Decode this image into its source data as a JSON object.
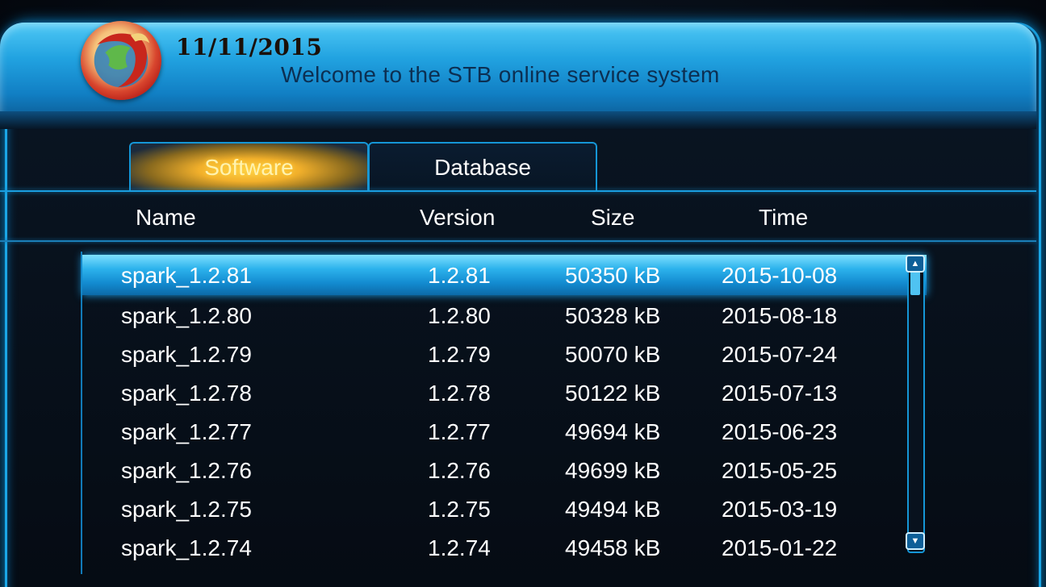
{
  "header": {
    "date": "11/11/2015",
    "welcome": "Welcome to the STB online service system"
  },
  "tabs": [
    {
      "label": "Software",
      "active": true
    },
    {
      "label": "Database",
      "active": false
    }
  ],
  "columns": {
    "name": "Name",
    "version": "Version",
    "size": "Size",
    "time": "Time"
  },
  "rows": [
    {
      "name": "spark_1.2.81",
      "version": "1.2.81",
      "size": "50350 kB",
      "time": "2015-10-08",
      "selected": true
    },
    {
      "name": "spark_1.2.80",
      "version": "1.2.80",
      "size": "50328 kB",
      "time": "2015-08-18"
    },
    {
      "name": "spark_1.2.79",
      "version": "1.2.79",
      "size": "50070 kB",
      "time": "2015-07-24"
    },
    {
      "name": "spark_1.2.78",
      "version": "1.2.78",
      "size": "50122 kB",
      "time": "2015-07-13"
    },
    {
      "name": "spark_1.2.77",
      "version": "1.2.77",
      "size": "49694 kB",
      "time": "2015-06-23"
    },
    {
      "name": "spark_1.2.76",
      "version": "1.2.76",
      "size": "49699 kB",
      "time": "2015-05-25"
    },
    {
      "name": "spark_1.2.75",
      "version": "1.2.75",
      "size": "49494 kB",
      "time": "2015-03-19"
    },
    {
      "name": "spark_1.2.74",
      "version": "1.2.74",
      "size": "49458 kB",
      "time": "2015-01-22"
    }
  ],
  "icons": {
    "logo": "brand-logo-icon",
    "scroll_up": "chevron-up-icon",
    "scroll_down": "chevron-down-icon"
  },
  "colors": {
    "accent_blue": "#1aa6e6",
    "selected_row": "#2cb2ec",
    "active_tab": "#f2b02b"
  }
}
